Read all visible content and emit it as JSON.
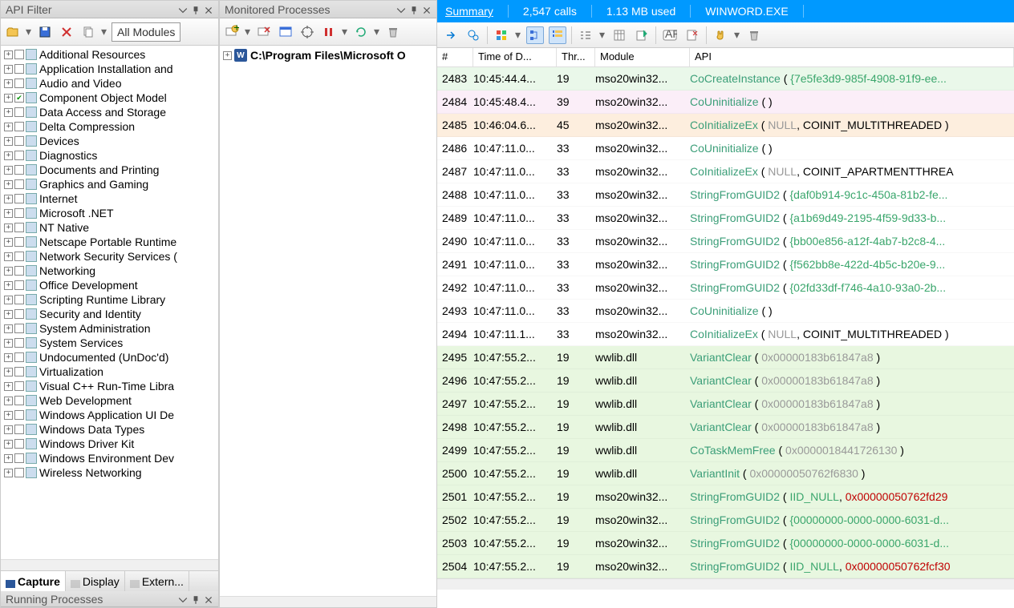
{
  "left": {
    "title": "API Filter",
    "combo": "All Modules",
    "categories": [
      {
        "label": "Additional Resources",
        "checked": false
      },
      {
        "label": "Application Installation and",
        "checked": false
      },
      {
        "label": "Audio and Video",
        "checked": false
      },
      {
        "label": "Component Object Model",
        "checked": true
      },
      {
        "label": "Data Access and Storage",
        "checked": false
      },
      {
        "label": "Delta Compression",
        "checked": false
      },
      {
        "label": "Devices",
        "checked": false
      },
      {
        "label": "Diagnostics",
        "checked": false
      },
      {
        "label": "Documents and Printing",
        "checked": false
      },
      {
        "label": "Graphics and Gaming",
        "checked": false
      },
      {
        "label": "Internet",
        "checked": false
      },
      {
        "label": "Microsoft .NET",
        "checked": false
      },
      {
        "label": "NT Native",
        "checked": false
      },
      {
        "label": "Netscape Portable Runtime",
        "checked": false
      },
      {
        "label": "Network Security Services (",
        "checked": false
      },
      {
        "label": "Networking",
        "checked": false
      },
      {
        "label": "Office Development",
        "checked": false
      },
      {
        "label": "Scripting Runtime Library",
        "checked": false
      },
      {
        "label": "Security and Identity",
        "checked": false
      },
      {
        "label": "System Administration",
        "checked": false
      },
      {
        "label": "System Services",
        "checked": false
      },
      {
        "label": "Undocumented (UnDoc'd)",
        "checked": false
      },
      {
        "label": "Virtualization",
        "checked": false
      },
      {
        "label": "Visual C++ Run-Time Libra",
        "checked": false
      },
      {
        "label": "Web Development",
        "checked": false
      },
      {
        "label": "Windows Application UI De",
        "checked": false
      },
      {
        "label": "Windows Data Types",
        "checked": false
      },
      {
        "label": "Windows Driver Kit",
        "checked": false
      },
      {
        "label": "Windows Environment Dev",
        "checked": false
      },
      {
        "label": "Wireless Networking",
        "checked": false
      }
    ],
    "tabs": [
      "Capture",
      "Display",
      "Extern..."
    ],
    "running_title": "Running Processes"
  },
  "mid": {
    "title": "Monitored Processes",
    "item": "C:\\Program Files\\Microsoft O"
  },
  "summary": {
    "label": "Summary",
    "calls": "2,547 calls",
    "mem": "1.13 MB used",
    "proc": "WINWORD.EXE"
  },
  "cols": [
    "#",
    "Time of D...",
    "Thr...",
    "Module",
    "API"
  ],
  "rows": [
    {
      "n": "2483",
      "t": "10:45:44.4...",
      "th": "19",
      "m": "mso20win32...",
      "bg": "green",
      "api": [
        [
          "fn",
          "CoCreateInstance"
        ],
        [
          "pn",
          " ( "
        ],
        [
          "gu",
          "{7e5fe3d9-985f-4908-91f9-ee..."
        ]
      ]
    },
    {
      "n": "2484",
      "t": "10:45:48.4...",
      "th": "39",
      "m": "mso20win32...",
      "bg": "pink",
      "api": [
        [
          "fn",
          "CoUninitialize"
        ],
        [
          "pn",
          " (  )"
        ]
      ]
    },
    {
      "n": "2485",
      "t": "10:46:04.6...",
      "th": "45",
      "m": "mso20win32...",
      "bg": "peach",
      "api": [
        [
          "fn",
          "CoInitializeEx"
        ],
        [
          "pn",
          " ( "
        ],
        [
          "null",
          "NULL"
        ],
        [
          "pn",
          ", COINIT_MULTITHREADED )"
        ]
      ]
    },
    {
      "n": "2486",
      "t": "10:47:11.0...",
      "th": "33",
      "m": "mso20win32...",
      "bg": "",
      "api": [
        [
          "fn",
          "CoUninitialize"
        ],
        [
          "pn",
          " (  )"
        ]
      ]
    },
    {
      "n": "2487",
      "t": "10:47:11.0...",
      "th": "33",
      "m": "mso20win32...",
      "bg": "",
      "api": [
        [
          "fn",
          "CoInitializeEx"
        ],
        [
          "pn",
          " ( "
        ],
        [
          "null",
          "NULL"
        ],
        [
          "pn",
          ", COINIT_APARTMENTTHREA"
        ]
      ]
    },
    {
      "n": "2488",
      "t": "10:47:11.0...",
      "th": "33",
      "m": "mso20win32...",
      "bg": "",
      "api": [
        [
          "fn",
          "StringFromGUID2"
        ],
        [
          "pn",
          " ( "
        ],
        [
          "gu",
          "{daf0b914-9c1c-450a-81b2-fe..."
        ]
      ]
    },
    {
      "n": "2489",
      "t": "10:47:11.0...",
      "th": "33",
      "m": "mso20win32...",
      "bg": "",
      "api": [
        [
          "fn",
          "StringFromGUID2"
        ],
        [
          "pn",
          " ( "
        ],
        [
          "gu",
          "{a1b69d49-2195-4f59-9d33-b..."
        ]
      ]
    },
    {
      "n": "2490",
      "t": "10:47:11.0...",
      "th": "33",
      "m": "mso20win32...",
      "bg": "",
      "api": [
        [
          "fn",
          "StringFromGUID2"
        ],
        [
          "pn",
          " ( "
        ],
        [
          "gu",
          "{bb00e856-a12f-4ab7-b2c8-4..."
        ]
      ]
    },
    {
      "n": "2491",
      "t": "10:47:11.0...",
      "th": "33",
      "m": "mso20win32...",
      "bg": "",
      "api": [
        [
          "fn",
          "StringFromGUID2"
        ],
        [
          "pn",
          " ( "
        ],
        [
          "gu",
          "{f562bb8e-422d-4b5c-b20e-9..."
        ]
      ]
    },
    {
      "n": "2492",
      "t": "10:47:11.0...",
      "th": "33",
      "m": "mso20win32...",
      "bg": "",
      "api": [
        [
          "fn",
          "StringFromGUID2"
        ],
        [
          "pn",
          " ( "
        ],
        [
          "gu",
          "{02fd33df-f746-4a10-93a0-2b..."
        ]
      ]
    },
    {
      "n": "2493",
      "t": "10:47:11.0...",
      "th": "33",
      "m": "mso20win32...",
      "bg": "",
      "api": [
        [
          "fn",
          "CoUninitialize"
        ],
        [
          "pn",
          " (  )"
        ]
      ]
    },
    {
      "n": "2494",
      "t": "10:47:11.1...",
      "th": "33",
      "m": "mso20win32...",
      "bg": "",
      "api": [
        [
          "fn",
          "CoInitializeEx"
        ],
        [
          "pn",
          " ( "
        ],
        [
          "null",
          "NULL"
        ],
        [
          "pn",
          ", COINIT_MULTITHREADED )"
        ]
      ]
    },
    {
      "n": "2495",
      "t": "10:47:55.2...",
      "th": "19",
      "m": "wwlib.dll",
      "bg": "lgreen",
      "api": [
        [
          "fn",
          "VariantClear"
        ],
        [
          "pn",
          " ( "
        ],
        [
          "gray",
          "0x00000183b61847a8"
        ],
        [
          "pn",
          " )"
        ]
      ]
    },
    {
      "n": "2496",
      "t": "10:47:55.2...",
      "th": "19",
      "m": "wwlib.dll",
      "bg": "lgreen",
      "api": [
        [
          "fn",
          "VariantClear"
        ],
        [
          "pn",
          " ( "
        ],
        [
          "gray",
          "0x00000183b61847a8"
        ],
        [
          "pn",
          " )"
        ]
      ]
    },
    {
      "n": "2497",
      "t": "10:47:55.2...",
      "th": "19",
      "m": "wwlib.dll",
      "bg": "lgreen",
      "api": [
        [
          "fn",
          "VariantClear"
        ],
        [
          "pn",
          " ( "
        ],
        [
          "gray",
          "0x00000183b61847a8"
        ],
        [
          "pn",
          " )"
        ]
      ]
    },
    {
      "n": "2498",
      "t": "10:47:55.2...",
      "th": "19",
      "m": "wwlib.dll",
      "bg": "lgreen",
      "api": [
        [
          "fn",
          "VariantClear"
        ],
        [
          "pn",
          " ( "
        ],
        [
          "gray",
          "0x00000183b61847a8"
        ],
        [
          "pn",
          " )"
        ]
      ]
    },
    {
      "n": "2499",
      "t": "10:47:55.2...",
      "th": "19",
      "m": "wwlib.dll",
      "bg": "lgreen",
      "api": [
        [
          "fn",
          "CoTaskMemFree"
        ],
        [
          "pn",
          " ( "
        ],
        [
          "gray",
          "0x0000018441726130"
        ],
        [
          "pn",
          " )"
        ]
      ]
    },
    {
      "n": "2500",
      "t": "10:47:55.2...",
      "th": "19",
      "m": "wwlib.dll",
      "bg": "lgreen",
      "api": [
        [
          "fn",
          "VariantInit"
        ],
        [
          "pn",
          " ( "
        ],
        [
          "gray",
          "0x00000050762f6830"
        ],
        [
          "pn",
          " )"
        ]
      ]
    },
    {
      "n": "2501",
      "t": "10:47:55.2...",
      "th": "19",
      "m": "mso20win32...",
      "bg": "lgreen",
      "api": [
        [
          "fn",
          "StringFromGUID2"
        ],
        [
          "pn",
          " ( "
        ],
        [
          "gu",
          "IID_NULL"
        ],
        [
          "pn",
          ", "
        ],
        [
          "red",
          "0x00000050762fd29"
        ]
      ]
    },
    {
      "n": "2502",
      "t": "10:47:55.2...",
      "th": "19",
      "m": "mso20win32...",
      "bg": "lgreen",
      "api": [
        [
          "fn",
          "StringFromGUID2"
        ],
        [
          "pn",
          " ( "
        ],
        [
          "gu",
          "{00000000-0000-0000-6031-d..."
        ]
      ]
    },
    {
      "n": "2503",
      "t": "10:47:55.2...",
      "th": "19",
      "m": "mso20win32...",
      "bg": "lgreen",
      "api": [
        [
          "fn",
          "StringFromGUID2"
        ],
        [
          "pn",
          " ( "
        ],
        [
          "gu",
          "{00000000-0000-0000-6031-d..."
        ]
      ]
    },
    {
      "n": "2504",
      "t": "10:47:55.2...",
      "th": "19",
      "m": "mso20win32...",
      "bg": "lgreen",
      "api": [
        [
          "fn",
          "StringFromGUID2"
        ],
        [
          "pn",
          " ( "
        ],
        [
          "gu",
          "IID_NULL"
        ],
        [
          "pn",
          ", "
        ],
        [
          "red",
          "0x00000050762fcf30"
        ]
      ]
    }
  ]
}
